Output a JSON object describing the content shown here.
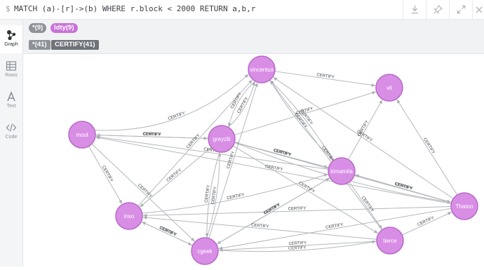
{
  "editor": {
    "prompt": "$",
    "query": "MATCH (a)-[r]->(b) WHERE r.block < 2000 RETURN a,b,r"
  },
  "toolbar": {
    "download_icon": "download-icon",
    "pin_icon": "pin-icon",
    "expand_icon": "expand-icon",
    "close_icon": "close-icon"
  },
  "sidebar": {
    "items": [
      {
        "label": "Graph",
        "icon": "graph-icon",
        "active": true
      },
      {
        "label": "Rows",
        "icon": "table-icon",
        "active": false
      },
      {
        "label": "Text",
        "icon": "text-icon",
        "active": false
      },
      {
        "label": "Code",
        "icon": "code-icon",
        "active": false
      }
    ]
  },
  "filters": {
    "node_all": "*(9)",
    "node_label": "Idty(9)",
    "rel_all": "*(41)",
    "rel_type": "CERTIFY(41)"
  },
  "colors": {
    "node_fill": "#d98ee6",
    "node_stroke": "#b86ac8",
    "label_pill": "#c773d6",
    "gray_pill": "#8e9298",
    "rel_pill": "#6f7378"
  },
  "graph": {
    "nodes": [
      {
        "id": "vincentux",
        "label": "vincentux"
      },
      {
        "id": "vit",
        "label": "vit"
      },
      {
        "id": "moul",
        "label": "moul"
      },
      {
        "id": "greyzlii",
        "label": "greyzlii"
      },
      {
        "id": "kimamila",
        "label": "kimamila"
      },
      {
        "id": "inso",
        "label": "inso"
      },
      {
        "id": "Thatoo",
        "label": "Thatoo"
      },
      {
        "id": "tierce",
        "label": "tierce"
      },
      {
        "id": "cgeek",
        "label": "cgeek"
      }
    ],
    "relationship_label": "CERTIFY"
  }
}
